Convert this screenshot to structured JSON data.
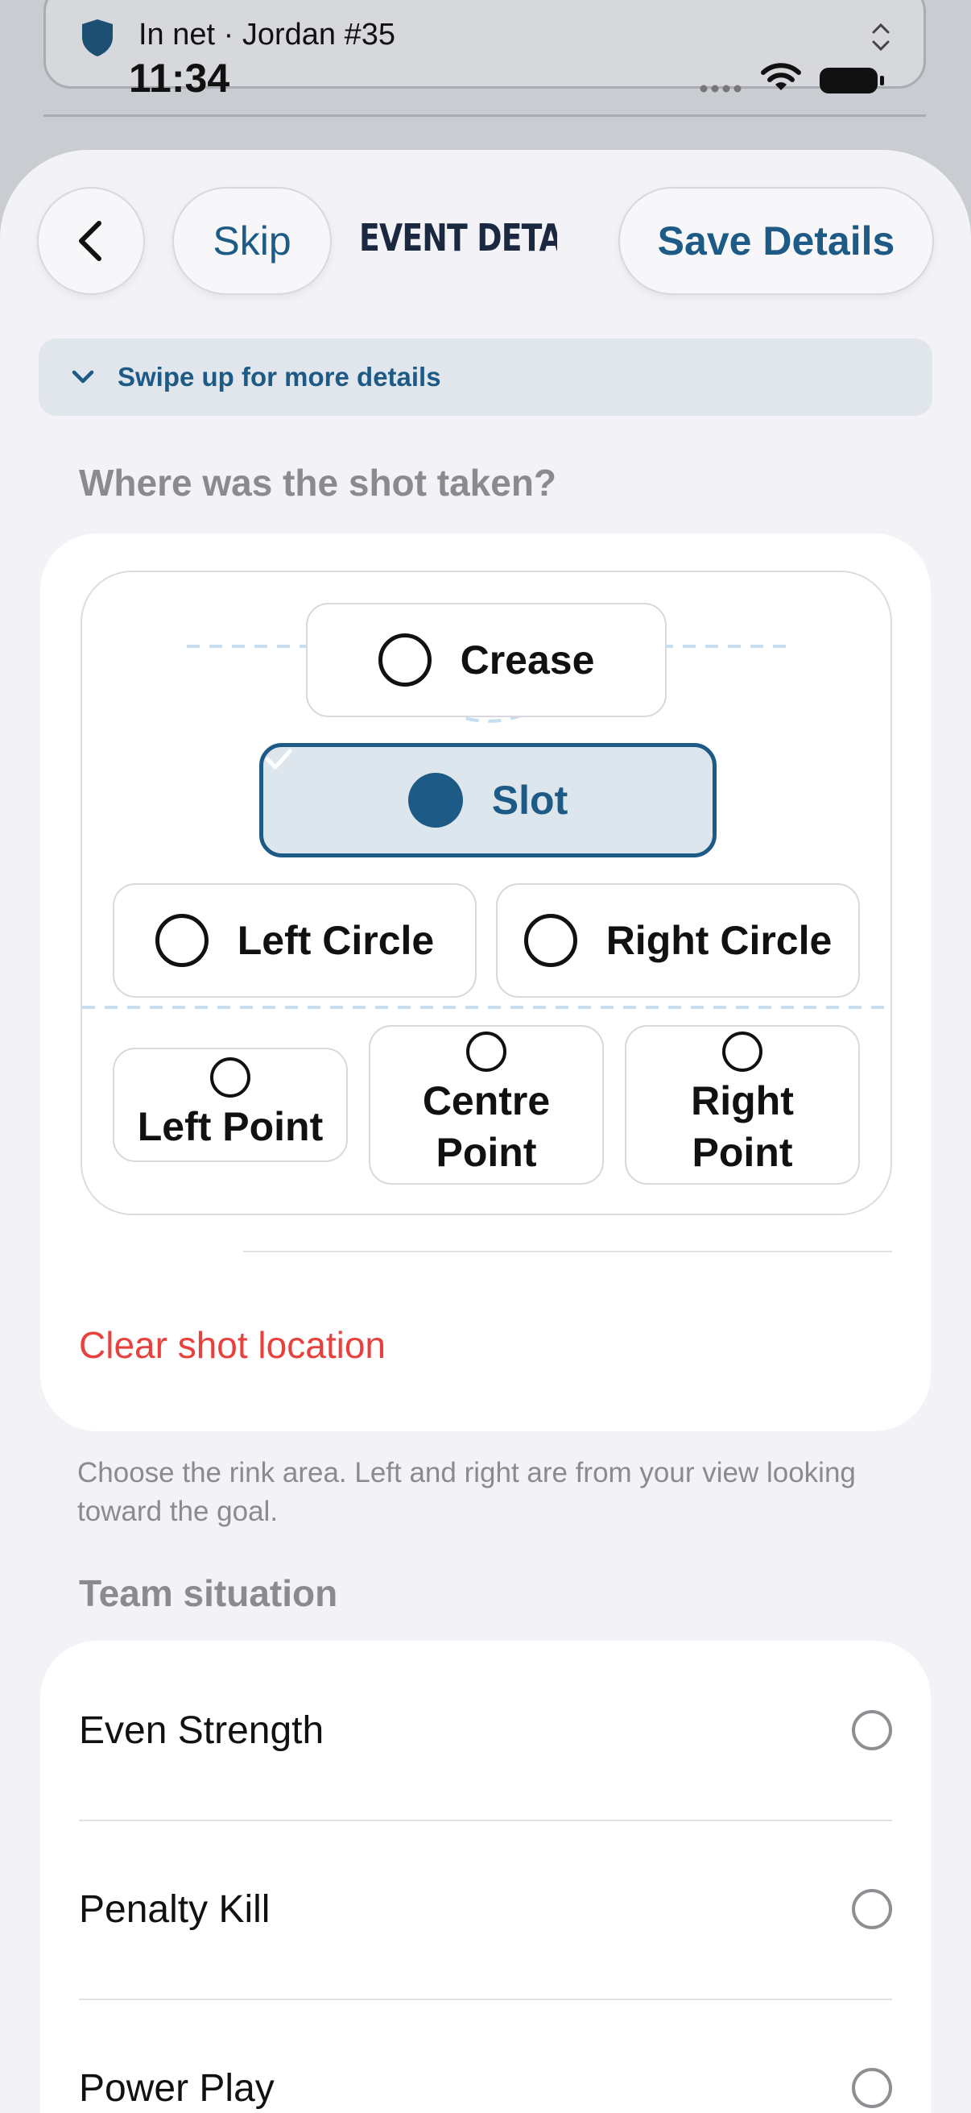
{
  "background": {
    "banner_text": "In net · Jordan #35"
  },
  "status_bar": {
    "time": "11:34"
  },
  "nav": {
    "skip_label": "Skip",
    "title": "EVENT DETAI...",
    "save_label": "Save Details"
  },
  "hint": {
    "text": "Swipe up for more details"
  },
  "shot_location": {
    "header": "Where was the shot taken?",
    "zones": {
      "crease": "Crease",
      "slot": "Slot",
      "left_circle": "Left Circle",
      "right_circle": "Right Circle",
      "left_point": "Left Point",
      "centre_point_1": "Centre",
      "centre_point_2": "Point",
      "right_point_1": "Right",
      "right_point_2": "Point"
    },
    "selected_zone": "Slot",
    "clear_label": "Clear shot location",
    "footnote": "Choose the rink area. Left and right are from your view looking toward the goal."
  },
  "team_situation": {
    "header": "Team situation",
    "options": [
      "Even Strength",
      "Penalty Kill",
      "Power Play"
    ]
  },
  "colors": {
    "accent": "#1d5a85",
    "destructive": "#e8413d",
    "sheet_bg": "#f2f2f7"
  }
}
